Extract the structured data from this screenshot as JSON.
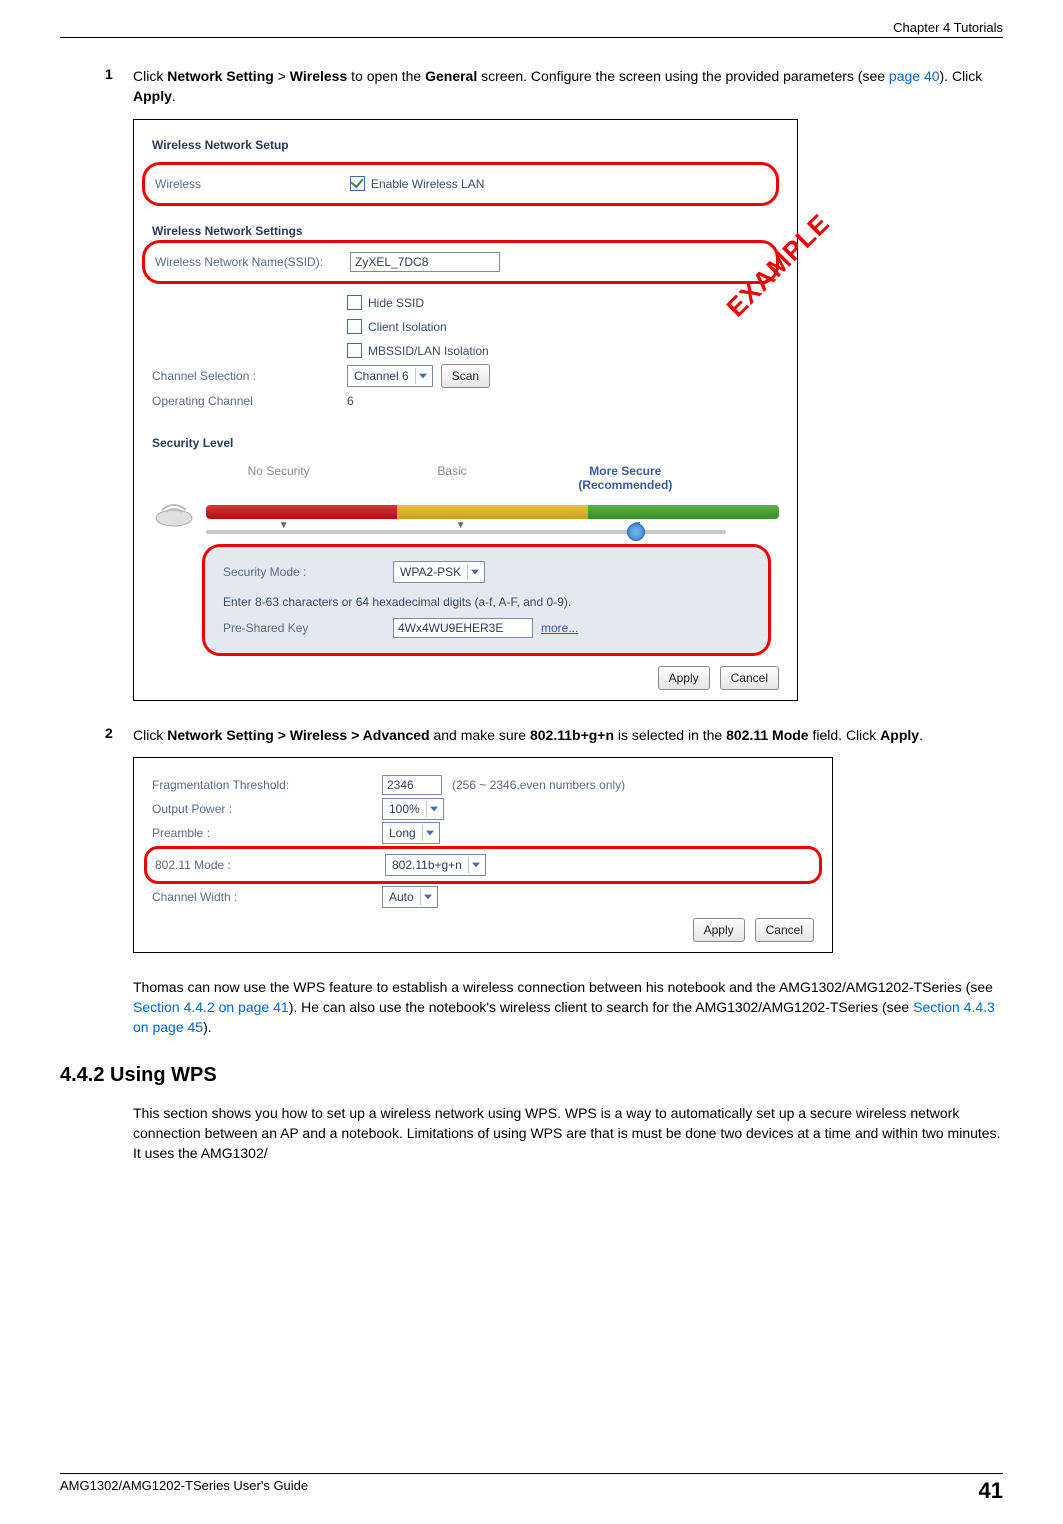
{
  "header": {
    "chapter": "Chapter 4 Tutorials"
  },
  "footer": {
    "guide": "AMG1302/AMG1202-TSeries User's Guide",
    "page_number": "41"
  },
  "stamp": "EXAMPLE",
  "step1": {
    "num": "1",
    "text_before": "Click ",
    "bold1": "Network Setting",
    "gt": " > ",
    "bold2": "Wireless",
    "text_mid": " to open the ",
    "bold3": "General",
    "text_after": " screen. Configure the screen using the provided parameters (see ",
    "link": "page 40",
    "text_end": "). Click ",
    "bold4": "Apply",
    "period": "."
  },
  "sc1": {
    "net_setup_title": "Wireless Network Setup",
    "wireless_label": "Wireless",
    "enable_label": "Enable Wireless LAN",
    "net_settings_title": "Wireless Network Settings",
    "ssid_label": "Wireless Network Name(SSID):",
    "ssid_value": "ZyXEL_7DC8",
    "hide_ssid": "Hide SSID",
    "client_iso": "Client Isolation",
    "mbssid_iso": "MBSSID/LAN Isolation",
    "channel_sel_label": "Channel Selection :",
    "channel_sel_value": "Channel 6",
    "scan_btn": "Scan",
    "op_channel_label": "Operating Channel",
    "op_channel_value": "6",
    "sec_level_title": "Security Level",
    "levels": {
      "no": "No Security",
      "basic": "Basic",
      "more1": "More Secure",
      "more2": "(Recommended)"
    },
    "sec_mode_label": "Security Mode :",
    "sec_mode_value": "WPA2-PSK",
    "psk_hint": "Enter 8-63 characters or 64 hexadecimal digits (a-f, A-F, and 0-9).",
    "psk_label": "Pre-Shared Key",
    "psk_value": "4Wx4WU9EHER3E",
    "more_link": "more...",
    "apply": "Apply",
    "cancel": "Cancel"
  },
  "step2": {
    "num": "2",
    "text_before": "Click ",
    "bold1": "Network Setting > Wireless > Advanced",
    "text_mid": " and make sure ",
    "bold2": "802.11b+g+n",
    "text_mid2": " is selected in the ",
    "bold3": "802.11 Mode",
    "text_after": " field. Click ",
    "bold4": "Apply",
    "period": "."
  },
  "sc2": {
    "frag_label": "Fragmentation Threshold:",
    "frag_value": "2346",
    "frag_hint": "(256 ~ 2346,even numbers only)",
    "out_label": "Output Power :",
    "out_value": "100%",
    "pre_label": "Preamble :",
    "pre_value": "Long",
    "mode_label": "802.11 Mode :",
    "mode_value": "802.11b+g+n",
    "cw_label": "Channel Width :",
    "cw_value": "Auto",
    "apply": "Apply",
    "cancel": "Cancel"
  },
  "paragraph": {
    "p1a": "Thomas can now use the WPS feature to establish a wireless connection between his notebook and the AMG1302/AMG1202-TSeries (see ",
    "link1": "Section 4.4.2 on page 41",
    "p1b": "). He can also use the notebook's wireless client to search for the AMG1302/AMG1202-TSeries (see ",
    "link2": "Section 4.4.3 on page 45",
    "p1c": ")."
  },
  "heading442": "4.4.2  Using WPS",
  "paragraph2": "This section shows you how to set up a wireless network using WPS. WPS is a way to automatically set up a secure wireless network connection between an AP and a notebook. Limitations of using WPS are that is must be done two devices at a time and within two minutes. It uses the AMG1302/"
}
